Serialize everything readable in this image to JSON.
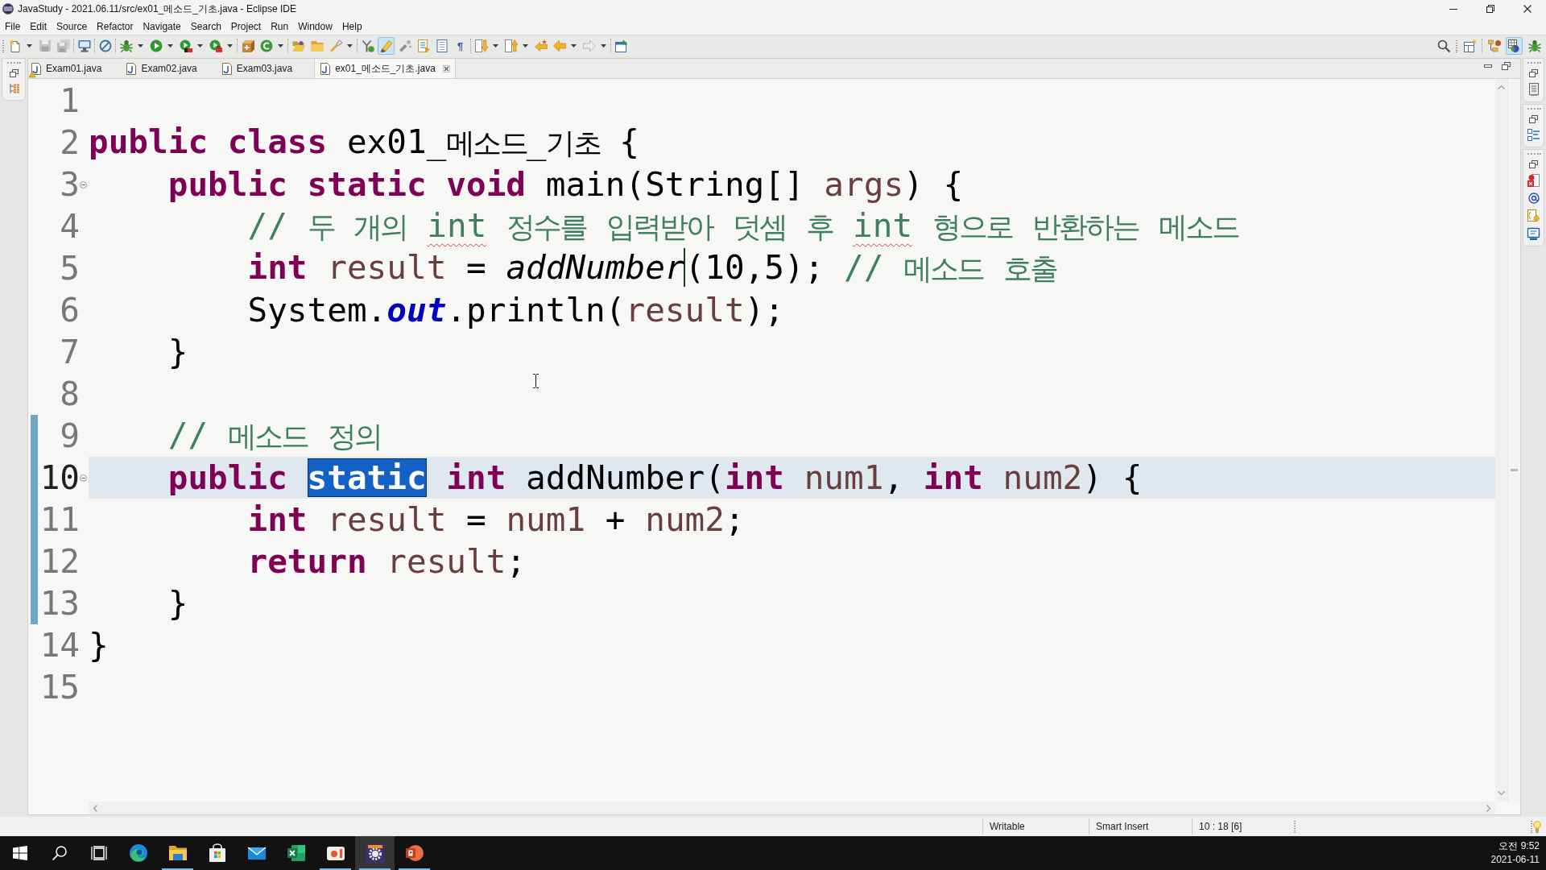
{
  "window": {
    "title": "JavaStudy - 2021.06.11/src/ex01_메소드_기초.java - Eclipse IDE"
  },
  "menu": [
    "File",
    "Edit",
    "Source",
    "Refactor",
    "Navigate",
    "Search",
    "Project",
    "Run",
    "Window",
    "Help"
  ],
  "toolbar": {
    "toggle": {
      "on": true
    },
    "whitespace_glyph": "¶"
  },
  "perspectives": [
    {
      "selected": false
    },
    {
      "selected": true
    },
    {
      "selected": false
    }
  ],
  "tabs": [
    {
      "label": "Exam01.java",
      "selected": false,
      "warning": true
    },
    {
      "label": "Exam02.java",
      "selected": false,
      "warning": false
    },
    {
      "label": "Exam03.java",
      "selected": false,
      "warning": false
    },
    {
      "label": "ex01_메소드_기초.java",
      "selected": true,
      "warning": false
    }
  ],
  "editor": {
    "lines": [
      {
        "number": "1",
        "current": false,
        "in_range": false
      },
      {
        "number": "2",
        "current": false,
        "in_range": false,
        "tokens": [
          {
            "text": "public class",
            "kind": "keyword",
            "selected": false,
            "caret": false
          },
          {
            "text": " ex01_메소드_기초 {",
            "kind": "plain",
            "selected": false,
            "caret": false
          }
        ],
        "children": [
          {
            "number": "3",
            "current": false,
            "in_range": false,
            "expanded": true,
            "tokens": [
              {
                "text": "public static void",
                "kind": "keyword",
                "selected": false,
                "caret": false
              },
              {
                "text": " main(String[] ",
                "kind": "plain",
                "selected": false,
                "caret": false
              },
              {
                "text": "args",
                "kind": "variable",
                "selected": false,
                "caret": false
              },
              {
                "text": ") {",
                "kind": "plain",
                "selected": false,
                "caret": false
              }
            ],
            "children": [
              {
                "number": "4",
                "current": false,
                "in_range": false,
                "tokens": [
                  {
                    "text": "// 두 개의 ",
                    "kind": "comment",
                    "selected": false,
                    "caret": false
                  },
                  {
                    "text": "int",
                    "kind": "misspelled",
                    "selected": false,
                    "caret": false
                  },
                  {
                    "text": " 정수를 입력받아 덧셈 후 ",
                    "kind": "comment",
                    "selected": false,
                    "caret": false
                  },
                  {
                    "text": "int",
                    "kind": "misspelled",
                    "selected": false,
                    "caret": false
                  },
                  {
                    "text": " 형으로 반환하는 메소드",
                    "kind": "comment",
                    "selected": false,
                    "caret": false
                  }
                ]
              },
              {
                "number": "5",
                "current": false,
                "in_range": false,
                "tokens": [
                  {
                    "text": "int",
                    "kind": "keyword",
                    "selected": false,
                    "caret": false
                  },
                  {
                    "text": " result",
                    "kind": "variable",
                    "selected": false,
                    "caret": false
                  },
                  {
                    "text": " = ",
                    "kind": "plain",
                    "selected": false,
                    "caret": false
                  },
                  {
                    "text": "addNumber",
                    "kind": "static_call",
                    "selected": false,
                    "caret": true
                  },
                  {
                    "text": "(10,5); ",
                    "kind": "plain",
                    "selected": false,
                    "caret": false
                  },
                  {
                    "text": "// 메소드 호출",
                    "kind": "comment",
                    "selected": false,
                    "caret": false
                  }
                ]
              },
              {
                "number": "6",
                "current": false,
                "in_range": false,
                "tokens": [
                  {
                    "text": "System.",
                    "kind": "plain",
                    "selected": false,
                    "caret": false
                  },
                  {
                    "text": "out",
                    "kind": "static_field",
                    "selected": false,
                    "caret": false
                  },
                  {
                    "text": ".println(",
                    "kind": "plain",
                    "selected": false,
                    "caret": false
                  },
                  {
                    "text": "result",
                    "kind": "variable",
                    "selected": false,
                    "caret": false
                  },
                  {
                    "text": ");",
                    "kind": "plain",
                    "selected": false,
                    "caret": false
                  }
                ]
              }
            ]
          },
          {
            "number": "7",
            "current": false,
            "in_range": false,
            "tokens": [
              {
                "text": "}",
                "kind": "plain",
                "selected": false,
                "caret": false
              }
            ]
          },
          {
            "number": "8",
            "current": false,
            "in_range": false
          },
          {
            "number": "9",
            "current": false,
            "in_range": true,
            "tokens": [
              {
                "text": "// 메소드 정의",
                "kind": "comment",
                "selected": false,
                "caret": false
              }
            ]
          },
          {
            "number": "10",
            "current": true,
            "in_range": true,
            "expanded": true,
            "tokens": [
              {
                "text": "public ",
                "kind": "keyword",
                "selected": false,
                "caret": false
              },
              {
                "text": "static",
                "kind": "keyword",
                "selected": true,
                "caret": false
              },
              {
                "text": " int",
                "kind": "keyword",
                "selected": false,
                "caret": false
              },
              {
                "text": " addNumber(",
                "kind": "plain",
                "selected": false,
                "caret": false
              },
              {
                "text": "int",
                "kind": "keyword",
                "selected": false,
                "caret": false
              },
              {
                "text": " num1",
                "kind": "variable",
                "selected": false,
                "caret": false
              },
              {
                "text": ", ",
                "kind": "plain",
                "selected": false,
                "caret": false
              },
              {
                "text": "int",
                "kind": "keyword",
                "selected": false,
                "caret": false
              },
              {
                "text": " num2",
                "kind": "variable",
                "selected": false,
                "caret": false
              },
              {
                "text": ") {",
                "kind": "plain",
                "selected": false,
                "caret": false
              }
            ],
            "children": [
              {
                "number": "11",
                "current": false,
                "in_range": true,
                "tokens": [
                  {
                    "text": "int",
                    "kind": "keyword",
                    "selected": false,
                    "caret": false
                  },
                  {
                    "text": " result",
                    "kind": "variable",
                    "selected": false,
                    "caret": false
                  },
                  {
                    "text": " = ",
                    "kind": "plain",
                    "selected": false,
                    "caret": false
                  },
                  {
                    "text": "num1",
                    "kind": "variable",
                    "selected": false,
                    "caret": false
                  },
                  {
                    "text": " + ",
                    "kind": "plain",
                    "selected": false,
                    "caret": false
                  },
                  {
                    "text": "num2",
                    "kind": "variable",
                    "selected": false,
                    "caret": false
                  },
                  {
                    "text": ";",
                    "kind": "plain",
                    "selected": false,
                    "caret": false
                  }
                ]
              },
              {
                "number": "12",
                "current": false,
                "in_range": true,
                "tokens": [
                  {
                    "text": "return",
                    "kind": "keyword",
                    "selected": false,
                    "caret": false
                  },
                  {
                    "text": " result",
                    "kind": "variable",
                    "selected": false,
                    "caret": false
                  },
                  {
                    "text": ";",
                    "kind": "plain",
                    "selected": false,
                    "caret": false
                  }
                ]
              }
            ]
          },
          {
            "number": "13",
            "current": false,
            "in_range": true,
            "tokens": [
              {
                "text": "}",
                "kind": "plain",
                "selected": false,
                "caret": false
              }
            ]
          }
        ]
      },
      {
        "number": "14",
        "current": false,
        "in_range": false,
        "tokens": [
          {
            "text": "}",
            "kind": "plain",
            "selected": false,
            "caret": false
          }
        ]
      },
      {
        "number": "15",
        "current": false,
        "in_range": false
      }
    ]
  },
  "status_bar": [
    "Writable",
    "Smart Insert",
    "10 : 18 [6]"
  ],
  "taskbar": {
    "apps": [
      {
        "kind": "browser",
        "running": false,
        "selected": false
      },
      {
        "kind": "files",
        "running": true,
        "selected": false
      },
      {
        "kind": "store",
        "running": false,
        "selected": false
      },
      {
        "kind": "mail",
        "running": false,
        "selected": false
      },
      {
        "kind": "spreadsheet",
        "running": false,
        "selected": false
      },
      {
        "kind": "recorder",
        "running": true,
        "selected": false
      },
      {
        "kind": "ide",
        "running": true,
        "selected": true
      },
      {
        "kind": "slides",
        "running": true,
        "selected": false
      }
    ],
    "clock": {
      "time": "오전 9:52",
      "date": "2021-06-11"
    }
  }
}
